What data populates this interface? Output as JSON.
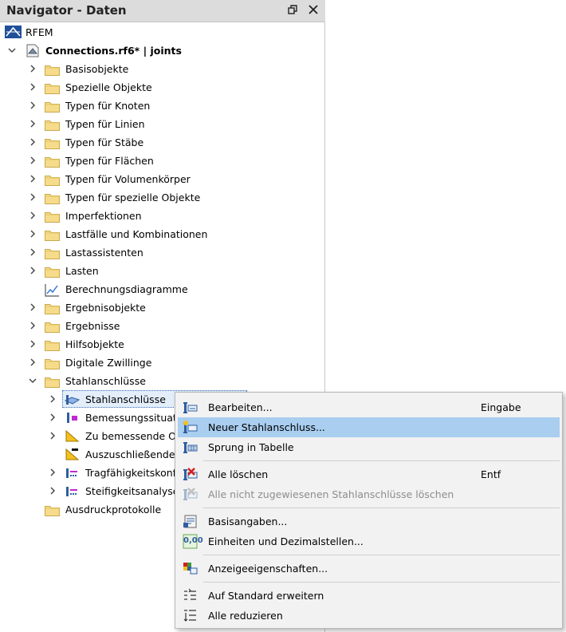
{
  "navigator": {
    "title": "Navigator - Daten",
    "restore_label": "🗗",
    "close_label": "✕"
  },
  "tree": {
    "root": "RFEM",
    "model": "Connections.rf6* | joints",
    "items": [
      "Basisobjekte",
      "Spezielle Objekte",
      "Typen für Knoten",
      "Typen für Linien",
      "Typen für Stäbe",
      "Typen für Flächen",
      "Typen für Volumenkörper",
      "Typen für spezielle Objekte",
      "Imperfektionen",
      "Lastfälle und Kombinationen",
      "Lastassistenten",
      "Lasten",
      "Berechnungsdiagramme",
      "Ergebnisobjekte",
      "Ergebnisse",
      "Hilfsobjekte",
      "Digitale Zwillinge",
      "Stahlanschlüsse"
    ],
    "children": [
      "Stahlanschlüsse",
      "Bemessungssituatio",
      "Zu bemessende Ob",
      "Auszuschließende O",
      "Tragfähigkeitskonfig",
      "Steifigkeitsanalyse-"
    ],
    "last": "Ausdruckprotokolle"
  },
  "context_menu": {
    "items": [
      {
        "label": "Bearbeiten...",
        "shortcut": "Eingabe"
      },
      {
        "label": "Neuer Stahlanschluss...",
        "shortcut": ""
      },
      {
        "label": "Sprung in Tabelle",
        "shortcut": ""
      },
      {
        "label": "Alle löschen",
        "shortcut": "Entf"
      },
      {
        "label": "Alle nicht zugewiesenen Stahlanschlüsse löschen",
        "shortcut": ""
      },
      {
        "label": "Basisangaben...",
        "shortcut": ""
      },
      {
        "label": "Einheiten und Dezimalstellen...",
        "shortcut": ""
      },
      {
        "label": "Anzeigeeigenschaften...",
        "shortcut": ""
      },
      {
        "label": "Auf Standard erweitern",
        "shortcut": ""
      },
      {
        "label": "Alle reduzieren",
        "shortcut": ""
      }
    ],
    "units_icon_text": "0,00"
  },
  "colors": {
    "folder": "#f6dc8a",
    "highlight": "#a9cef0",
    "accent": "#3d6fb6"
  }
}
